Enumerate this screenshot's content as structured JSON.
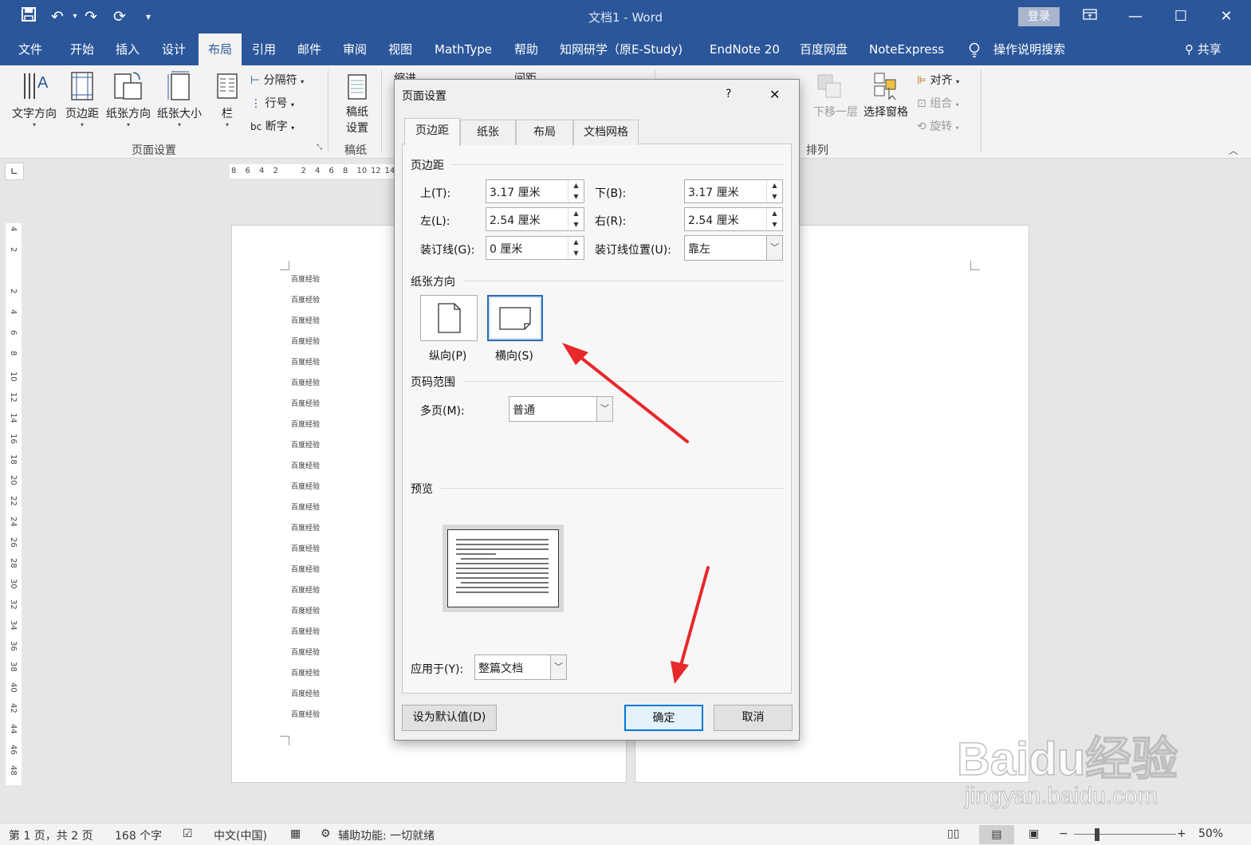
{
  "window": {
    "title": "文档1  -  Word",
    "login_label": "登录"
  },
  "menu_tabs": [
    "文件",
    "开始",
    "插入",
    "设计",
    "布局",
    "引用",
    "邮件",
    "审阅",
    "视图",
    "MathType",
    "帮助",
    "知网研学（原E-Study)",
    "EndNote 20",
    "百度网盘",
    "NoteExpress",
    "操作说明搜索"
  ],
  "share_label": "共享",
  "ribbon": {
    "text_direction": "文字方向",
    "margins": "页边距",
    "orientation": "纸张方向",
    "size": "纸张大小",
    "columns": "栏",
    "breaks": "分隔符",
    "line_numbers": "行号",
    "hyphenation": "断字",
    "manuscript": "稿纸\n设置",
    "manuscript_line1": "稿纸",
    "manuscript_line2": "设置",
    "group_page_setup": "页面设置",
    "group_manuscript": "稿纸",
    "indent_label": "缩进",
    "spacing_label": "间距",
    "send_backward": "下移一层",
    "selection_pane": "选择窗格",
    "align": "对齐",
    "group": "组合",
    "rotate": "旋转",
    "group_arrange": "排列"
  },
  "hruler_ticks": [
    "8",
    "6",
    "4",
    "2",
    "",
    "2",
    "4",
    "6",
    "8",
    "10",
    "12",
    "14"
  ],
  "vruler_ticks": [
    "4",
    "2",
    "",
    "2",
    "4",
    "6",
    "8",
    "10",
    "12",
    "14",
    "16",
    "18",
    "20",
    "22",
    "24",
    "26",
    "28",
    "30",
    "32",
    "34",
    "36",
    "38",
    "40",
    "42",
    "44",
    "46",
    "48"
  ],
  "document": {
    "line_text": "百度经验",
    "line_count": 22
  },
  "dialog": {
    "title": "页面设置",
    "help": "?",
    "close": "✕",
    "tabs": [
      "页边距",
      "纸张",
      "布局",
      "文档网格"
    ],
    "margins_section": "页边距",
    "top_label": "上(T):",
    "top_value": "3.17 厘米",
    "bottom_label": "下(B):",
    "bottom_value": "3.17 厘米",
    "left_label": "左(L):",
    "left_value": "2.54 厘米",
    "right_label": "右(R):",
    "right_value": "2.54 厘米",
    "gutter_label": "装订线(G):",
    "gutter_value": "0 厘米",
    "gutter_pos_label": "装订线位置(U):",
    "gutter_pos_value": "靠左",
    "orientation_section": "纸张方向",
    "portrait_label": "纵向(P)",
    "landscape_label": "横向(S)",
    "pages_section": "页码范围",
    "multiple_pages_label": "多页(M):",
    "multiple_pages_value": "普通",
    "preview_section": "预览",
    "apply_to_label": "应用于(Y):",
    "apply_to_value": "整篇文档",
    "default_button": "设为默认值(D)",
    "ok_button": "确定",
    "cancel_button": "取消"
  },
  "status": {
    "page": "第 1 页，共 2 页",
    "words": "168 个字",
    "language": "中文(中国)",
    "accessibility": "辅助功能: 一切就绪",
    "zoom": "50%"
  },
  "watermark": {
    "brand": "Baidu经验",
    "url": "jingyan.baidu.com"
  },
  "colors": {
    "word_blue": "#2b579a",
    "arrow_red": "#e8282b",
    "focus_blue": "#0078d7"
  }
}
